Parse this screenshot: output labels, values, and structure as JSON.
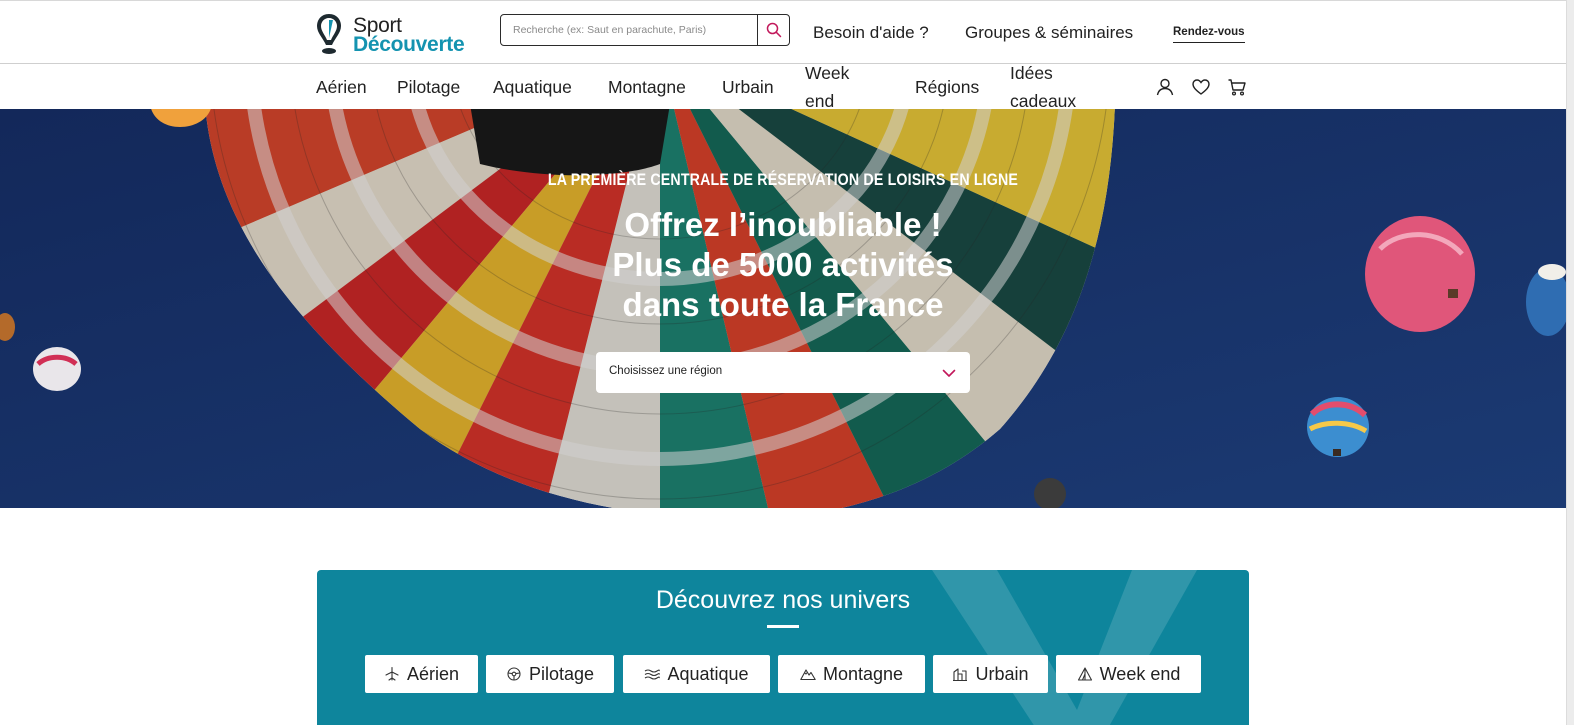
{
  "brand": {
    "line1": "Sport",
    "line2": "Découverte",
    "color": "#1493b0"
  },
  "search": {
    "placeholder": "Recherche (ex: Saut en parachute, Paris)",
    "icon": "search-icon",
    "icon_color": "#c2185b"
  },
  "top_links": [
    {
      "label": "Besoin d'aide ?"
    },
    {
      "label": "Groupes & séminaires"
    }
  ],
  "rdv_label": "Rendez-vous",
  "nav": [
    {
      "label": "Aérien"
    },
    {
      "label": "Pilotage"
    },
    {
      "label": "Aquatique"
    },
    {
      "label": "Montagne"
    },
    {
      "label": "Urbain"
    },
    {
      "label": "Week end"
    },
    {
      "label": "Régions"
    },
    {
      "label": "Idées cadeaux"
    }
  ],
  "nav_icons": [
    "user-icon",
    "heart-icon",
    "cart-icon"
  ],
  "hero": {
    "kicker": "LA PREMIÈRE CENTRALE DE RÉSERVATION DE LOISIRS EN LIGNE",
    "title_lines": [
      "Offrez l’inoubliable !",
      "Plus de 5000 activités",
      "dans toute la France"
    ],
    "region_select": "Choisissez une région"
  },
  "univers": {
    "title": "Découvrez nos univers",
    "chips": [
      {
        "label": "Aérien",
        "icon": "plane-icon"
      },
      {
        "label": "Pilotage",
        "icon": "steering-wheel-icon"
      },
      {
        "label": "Aquatique",
        "icon": "wave-icon"
      },
      {
        "label": "Montagne",
        "icon": "mountain-icon"
      },
      {
        "label": "Urbain",
        "icon": "building-icon"
      },
      {
        "label": "Week end",
        "icon": "tent-icon"
      }
    ]
  },
  "colors": {
    "accent": "#c2185b",
    "teal": "#0e859c",
    "sky": "#163160"
  }
}
